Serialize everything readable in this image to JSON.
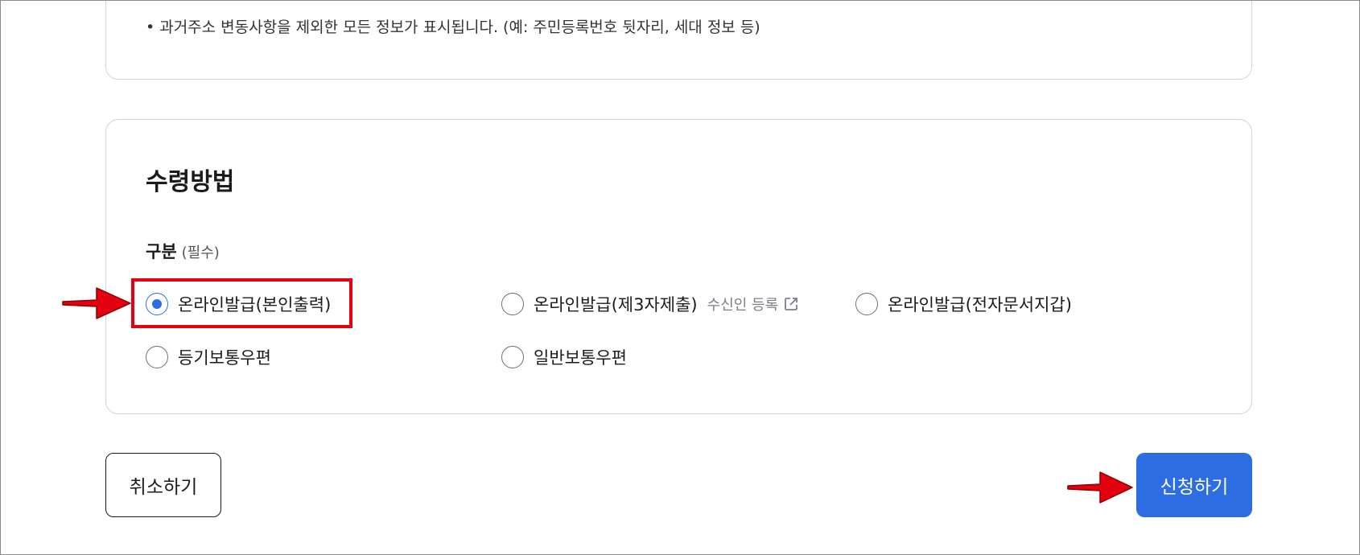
{
  "info_card": {
    "bullet": "•",
    "note": "과거주소 변동사항을 제외한 모든 정보가 표시됩니다. (예: 주민등록번호 뒷자리, 세대 정보 등)"
  },
  "receive_method": {
    "title": "수령방법",
    "field_label": "구분",
    "required_text": "(필수)",
    "options": [
      {
        "label": "온라인발급(본인출력)",
        "checked": true
      },
      {
        "label": "온라인발급(제3자제출)",
        "checked": false,
        "extra_link": "수신인 등록",
        "extra_icon": "external-link-icon"
      },
      {
        "label": "온라인발급(전자문서지갑)",
        "checked": false
      },
      {
        "label": "등기보통우편",
        "checked": false
      },
      {
        "label": "일반보통우편",
        "checked": false
      }
    ]
  },
  "buttons": {
    "cancel": "취소하기",
    "submit": "신청하기"
  },
  "colors": {
    "primary": "#2c6de3",
    "annotation_red": "#e3000f"
  }
}
